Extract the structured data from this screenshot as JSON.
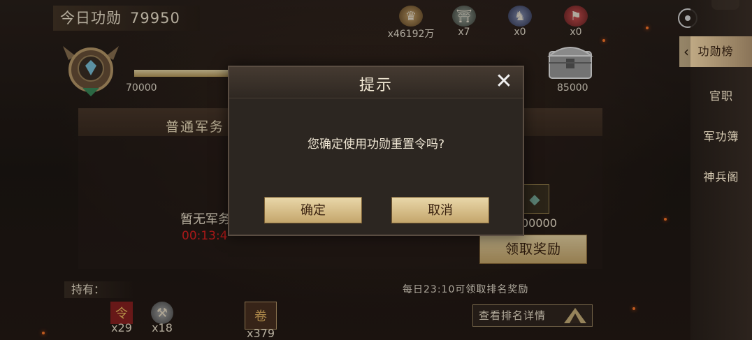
{
  "header": {
    "merit_label": "今日功勋",
    "merit_value": "79950"
  },
  "resources": [
    {
      "name": "general-icon",
      "count": "x46192万"
    },
    {
      "name": "tower-icon",
      "count": "x7"
    },
    {
      "name": "horse-rider-icon",
      "count": "x0"
    },
    {
      "name": "banner-icon",
      "count": "x0"
    }
  ],
  "progress": {
    "left_value": "70000",
    "right_value": "85000",
    "fill": 0.55
  },
  "panel": {
    "title": "普通军务",
    "empty_text": "暂无军务",
    "timer": "00:13:4",
    "reward_amount": "00000",
    "claim_label": "领取奖励"
  },
  "holdings": {
    "label": "持有：",
    "items": [
      {
        "name": "flag-token-icon",
        "count": "x29"
      },
      {
        "name": "hammer-icon",
        "count": "x18"
      },
      {
        "name": "scroll-icon",
        "count": "x379"
      }
    ]
  },
  "footer": {
    "daily_note": "每日23:10可领取排名奖励",
    "rank_details": "查看排名详情"
  },
  "sidebar": {
    "items": [
      "功勋榜",
      "官职",
      "军功簿",
      "神兵阁"
    ],
    "active_index": 0
  },
  "dialog": {
    "title": "提示",
    "message": "您确定使用功勋重置令吗?",
    "confirm": "确定",
    "cancel": "取消"
  },
  "colors": {
    "accent_gold": "#c7a86c",
    "timer_red": "#e02020",
    "panel_dark": "#2c2621"
  }
}
